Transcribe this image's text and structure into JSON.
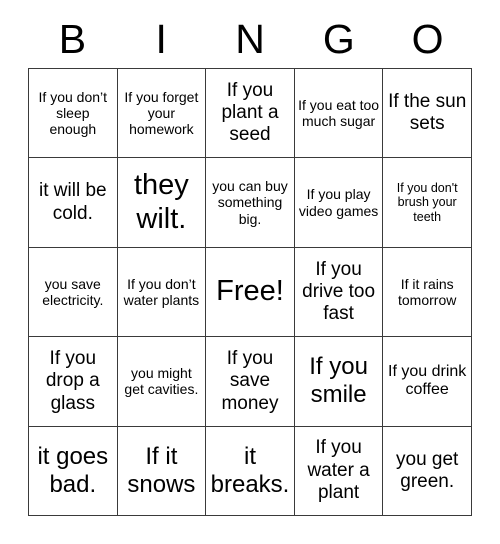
{
  "header": {
    "letters": [
      "B",
      "I",
      "N",
      "G",
      "O"
    ]
  },
  "grid": {
    "rows": 5,
    "columns": 5,
    "cells": [
      {
        "text": "If you don’t sleep enough",
        "size": "fs-sm"
      },
      {
        "text": "If you forget your homework",
        "size": "fs-sm"
      },
      {
        "text": "If you plant a seed",
        "size": "fs-lg"
      },
      {
        "text": "If you eat too much sugar",
        "size": "fs-sm"
      },
      {
        "text": "If the sun sets",
        "size": "fs-lg"
      },
      {
        "text": "it will be cold.",
        "size": "fs-lg"
      },
      {
        "text": "they wilt.",
        "size": "fs-xxl"
      },
      {
        "text": "you can buy something big.",
        "size": "fs-sm"
      },
      {
        "text": "If you play video games",
        "size": "fs-sm"
      },
      {
        "text": "If you don't brush your teeth",
        "size": "fs-xs"
      },
      {
        "text": "you save electricity.",
        "size": "fs-sm"
      },
      {
        "text": "If you don’t water plants",
        "size": "fs-sm"
      },
      {
        "text": "Free!",
        "size": "fs-xxl"
      },
      {
        "text": "If you drive too fast",
        "size": "fs-lg"
      },
      {
        "text": "If it rains tomorrow",
        "size": "fs-sm"
      },
      {
        "text": "If you drop a glass",
        "size": "fs-lg"
      },
      {
        "text": "you might get cavities.",
        "size": "fs-sm"
      },
      {
        "text": "If you save money",
        "size": "fs-lg"
      },
      {
        "text": "If you smile",
        "size": "fs-xl"
      },
      {
        "text": "If you drink coffee",
        "size": "fs-md"
      },
      {
        "text": "it goes bad.",
        "size": "fs-xl"
      },
      {
        "text": "If it snows",
        "size": "fs-xl"
      },
      {
        "text": "it breaks.",
        "size": "fs-xl"
      },
      {
        "text": "If you water a plant",
        "size": "fs-lg"
      },
      {
        "text": "you get green.",
        "size": "fs-lg"
      }
    ]
  },
  "colors": {
    "background": "#ffffff",
    "text": "#000000",
    "border": "#3a3a3a"
  }
}
